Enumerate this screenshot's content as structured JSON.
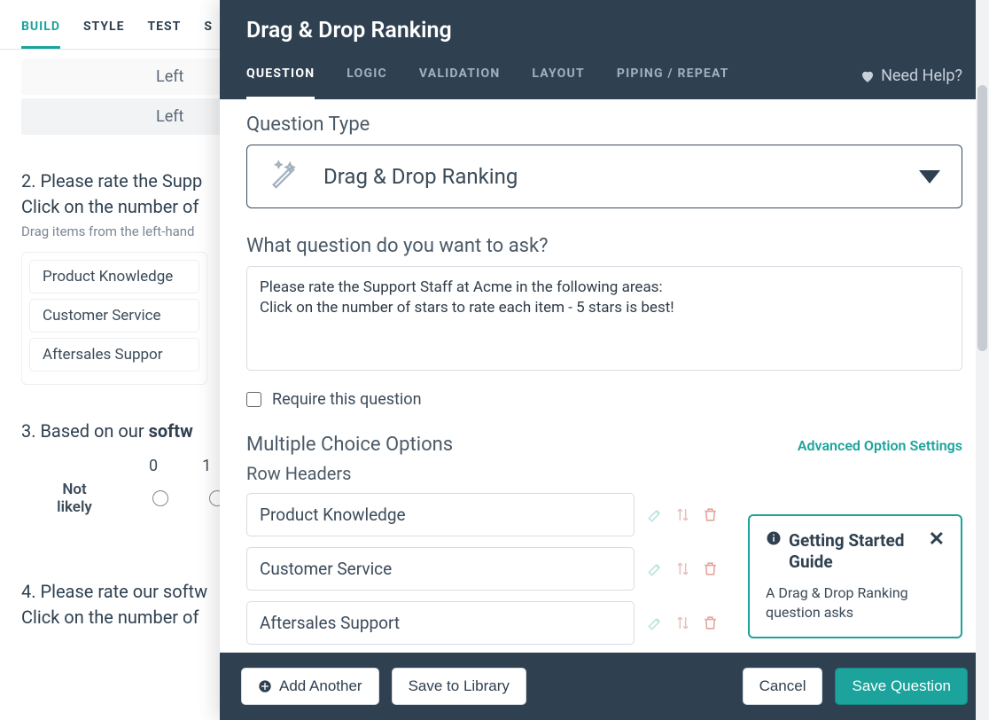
{
  "bg": {
    "tabs": {
      "build": "BUILD",
      "style": "STYLE",
      "test": "TEST",
      "extra": "S"
    },
    "leftrows": [
      "Left",
      "Left"
    ],
    "q2": {
      "title_prefix": "2. Please rate the Supp",
      "title_line2": "Click on the number of",
      "hint": "Drag items from the left-hand",
      "items": [
        "Product Knowledge",
        "Customer Service",
        "Aftersales Suppor"
      ]
    },
    "q3": {
      "title_html_prefix": "3. Based on our ",
      "title_bold": "softw",
      "scale_nums": [
        "0",
        "1"
      ],
      "row_label_line1": "Not",
      "row_label_line2": "likely"
    },
    "q4": {
      "title_prefix": "4. Please rate our softw",
      "title_line2": "Click on the number of"
    }
  },
  "modal": {
    "title": "Drag & Drop Ranking",
    "tabs": {
      "question": "QUESTION",
      "logic": "LOGIC",
      "validation": "VALIDATION",
      "layout": "LAYOUT",
      "piping": "PIPING / REPEAT"
    },
    "help": "Need Help?",
    "section_qtype": "Question Type",
    "qtype_name": "Drag & Drop Ranking",
    "section_qtext": "What question do you want to ask?",
    "qtext_value": "Please rate the Support Staff at Acme in the following areas:\nClick on the number of stars to rate each item - 5 stars is best!",
    "require_label": "Require this question",
    "mco_title": "Multiple Choice Options",
    "adv_link": "Advanced Option Settings",
    "row_headers_label": "Row Headers",
    "options": [
      "Product Knowledge",
      "Customer Service",
      "Aftersales Support"
    ],
    "gs": {
      "title": "Getting Started Guide",
      "body": "A Drag & Drop Ranking question asks"
    },
    "footer": {
      "add": "Add Another",
      "save_lib": "Save to Library",
      "cancel": "Cancel",
      "save": "Save Question"
    }
  }
}
